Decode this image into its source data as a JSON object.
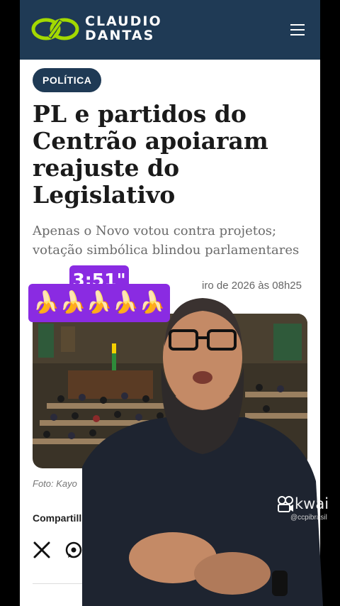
{
  "header": {
    "logo_name": "CLAUDIO DANTAS",
    "logo_line1": "CLAUDIO",
    "logo_line2": "DANTAS",
    "menu_icon": "hamburger-icon",
    "background_color": "#1f3a55",
    "accent_color": "#a3d900"
  },
  "article": {
    "category": "POLÍTICA",
    "title": "PL e partidos do Centrão apoiaram reajuste do Legislativo",
    "subtitle": "Apenas o Novo votou contra projetos; votação simbólica blindou parlamentares",
    "date_visible": "iro de 2026 às 08h25",
    "photo_caption": "Foto: Kayo",
    "share_label": "Compartill",
    "share_icons": [
      "x-icon",
      "whatsapp-icon"
    ]
  },
  "overlay": {
    "timer": "3:51\"",
    "emojis": "🍌🍌🍌🍌🍌",
    "overlay_color": "#8a2be2",
    "watermark_brand": "kwai",
    "watermark_handle": "@ccpibrasil"
  }
}
